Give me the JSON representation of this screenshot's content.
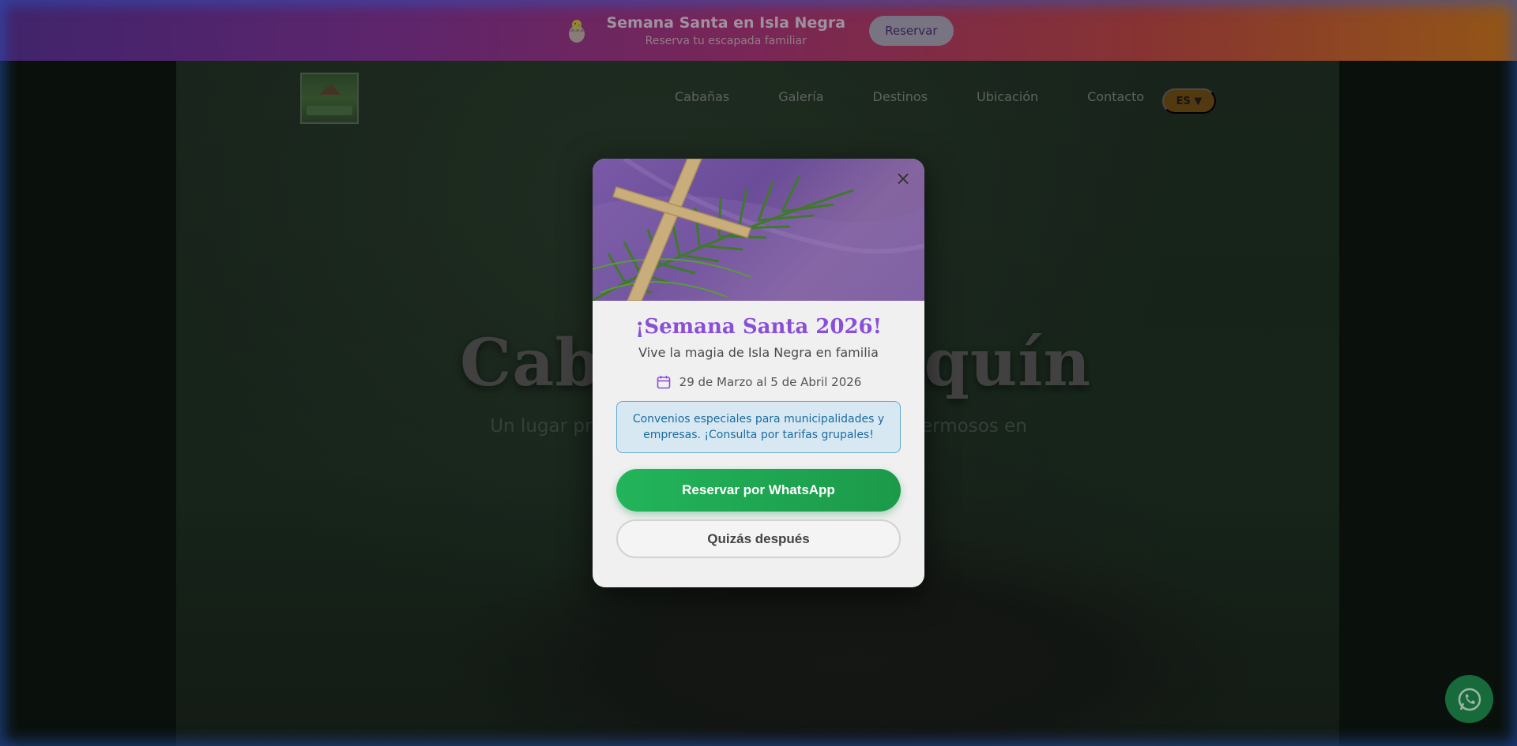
{
  "promo": {
    "title": "Semana Santa en Isla Negra",
    "subtitle": "Reserva tu escapada familiar",
    "button": "Reservar",
    "icon": "easter-egg-icon"
  },
  "nav": {
    "logo": "cabanas-logo",
    "items": [
      {
        "label": "Cabañas"
      },
      {
        "label": "Galería"
      },
      {
        "label": "Destinos"
      },
      {
        "label": "Ubicación"
      },
      {
        "label": "Contacto"
      }
    ],
    "language": "ES ▼"
  },
  "hero": {
    "title": "Caba            quín",
    "subtitle": "Un lugar privileg                                          es hermosos en"
  },
  "modal": {
    "image": "palm-cross-image",
    "title": "¡Semana Santa 2026!",
    "tagline": "Vive la magia de Isla Negra en familia",
    "dates": "29 de Marzo al 5 de Abril 2026",
    "info": "Convenios especiales para municipalidades y empresas. ¡Consulta por tarifas grupales!",
    "primary_button": "Reservar por WhatsApp",
    "secondary_button": "Quizás después",
    "close": "×"
  },
  "colors": {
    "accent_purple": "#8a4fd8",
    "whatsapp_green": "#22b45a",
    "info_blue": "#1b6b9e"
  }
}
